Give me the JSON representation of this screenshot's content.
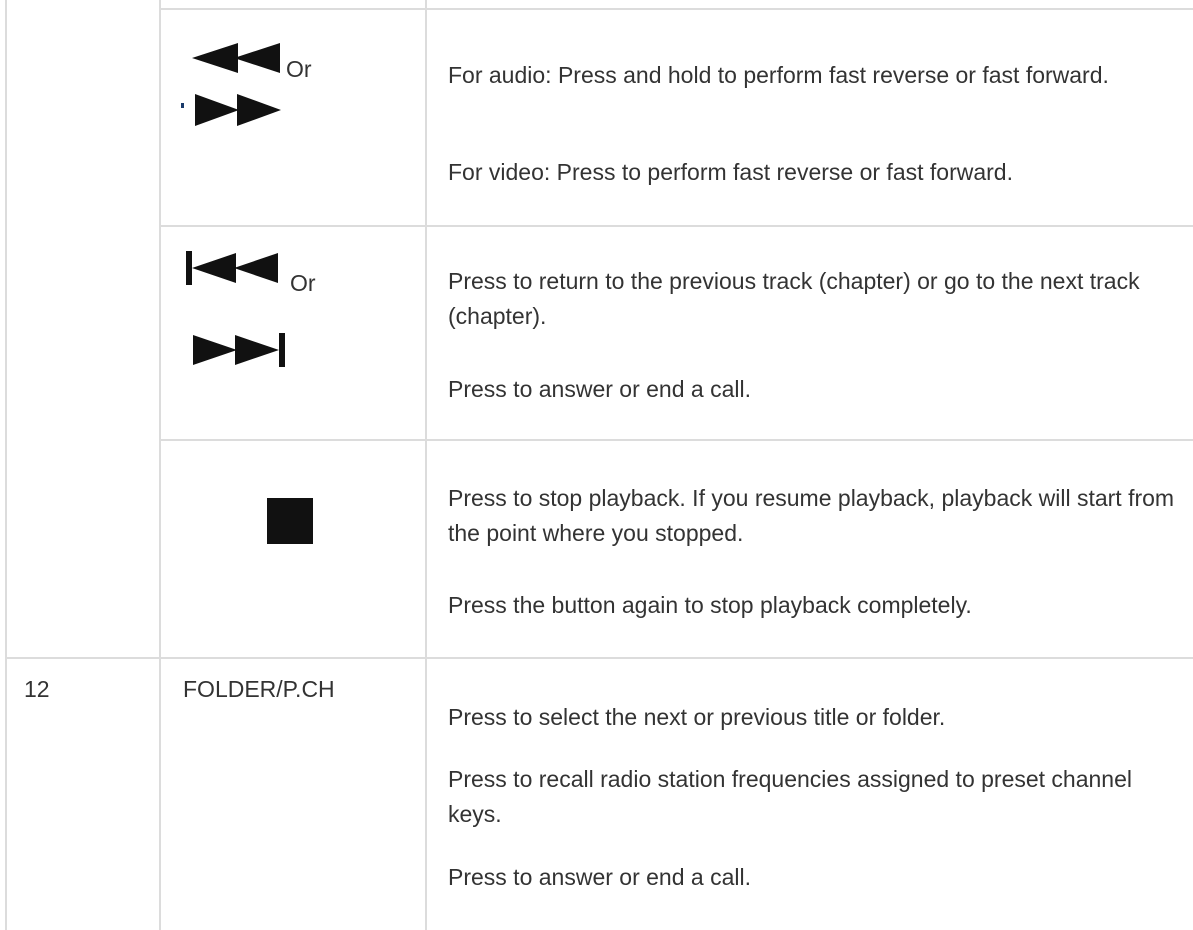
{
  "rows": [
    {
      "number": "",
      "icon_names": [
        "fast-reverse-icon",
        "fast-forward-icon"
      ],
      "or_label": "Or",
      "paragraphs": [
        "For audio: Press and hold to perform fast reverse or fast forward.",
        "For video: Press to perform fast reverse or fast forward."
      ]
    },
    {
      "number": "",
      "icon_names": [
        "previous-track-icon",
        "next-track-icon"
      ],
      "or_label": "Or",
      "paragraphs": [
        "Press to return to the previous track (chapter) or go to the next track (chapter).",
        "Press to answer or end a call."
      ]
    },
    {
      "number": "",
      "icon_names": [
        "stop-icon"
      ],
      "paragraphs": [
        "Press to stop playback. If you resume playback, playback will start from the point where you stopped.",
        "Press the button again to stop playback completely."
      ]
    },
    {
      "number": "12",
      "button_label": "FOLDER/P.CH",
      "paragraphs": [
        "Press to select the next or previous title or folder.",
        "Press to recall radio station frequencies assigned to preset channel keys.",
        "Press to answer or end a call."
      ]
    }
  ],
  "colors": {
    "border": "#dcdcdc",
    "text": "#333333",
    "icon": "#111111"
  }
}
